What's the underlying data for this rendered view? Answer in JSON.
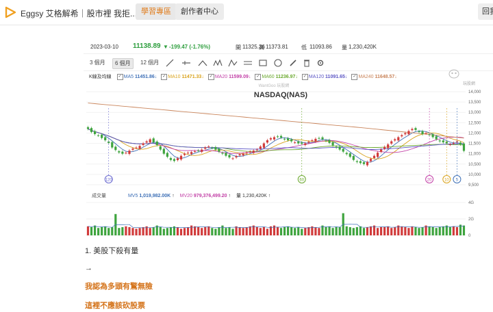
{
  "header": {
    "site_title": "Eggsy 艾格解希｜股市裡 我拒...",
    "learn_button": "學習專區",
    "creator_button": "創作者中心",
    "back_button": "回我"
  },
  "quote": {
    "date": "2023-03-10",
    "price": "11138.89",
    "change": "-199.47 (-1.76%)",
    "open_label": "開",
    "open": "11325.36",
    "high_label": "高",
    "high": "11373.81",
    "low_label": "低",
    "low": "11093.86",
    "volume_label": "量",
    "volume": "1,230,420K"
  },
  "periods": [
    "3 個月",
    "6 個月",
    "12 個月"
  ],
  "active_period": "6 個月",
  "tools": [
    "line-tool-icon",
    "ray-tool-icon",
    "triangle-tool-icon",
    "wave-tool-icon",
    "fibonacci-tool-icon",
    "parallel-tool-icon",
    "rectangle-tool-icon",
    "circle-tool-icon",
    "brush-tool-icon",
    "trash-icon",
    "settings-icon"
  ],
  "ma": {
    "label": "K線及均線",
    "items": [
      {
        "name": "MA5",
        "value": "11451.86",
        "dir": "↓",
        "color": "#3d6fb6"
      },
      {
        "name": "MA10",
        "value": "11471.33",
        "dir": "↓",
        "color": "#d9a21b"
      },
      {
        "name": "MA20",
        "value": "11599.09",
        "dir": "↓",
        "color": "#c23fa6"
      },
      {
        "name": "MA60",
        "value": "11236.97",
        "dir": "↓",
        "color": "#6aa82d"
      },
      {
        "name": "MA120",
        "value": "11091.65",
        "dir": "↓",
        "color": "#5b55c4"
      },
      {
        "name": "MA240",
        "value": "11648.57",
        "dir": "↓",
        "color": "#c9845a"
      }
    ]
  },
  "chart_title": "NASDAQ(NAS)",
  "watermark": "WantGoo 玩股網",
  "brand_badge": "玩股網",
  "volume": {
    "label": "成交量",
    "mv5_name": "MV5",
    "mv5": "1,019,982.00K",
    "mv5_dir": "↑",
    "mv20_name": "MV20",
    "mv20": "979,376,499.20",
    "mv20_dir": "↑",
    "volume_label": "量",
    "volume": "1,230,420K",
    "volume_dir": "↑"
  },
  "article": {
    "line1": "1. 美股下殺有量",
    "arrow": "→",
    "line2": "我認為多頭有驚無險",
    "line3": "這裡不應該砍股票"
  },
  "colors": {
    "up": "#d13b3b",
    "down": "#3ea43e",
    "accent": "#d4731a"
  },
  "chart_data": {
    "type": "candlestick",
    "title": "NASDAQ(NAS)",
    "y_ticks": [
      14000,
      13500,
      13000,
      12500,
      12000,
      11500,
      11000,
      10500,
      10000,
      9500
    ],
    "ylim": [
      9500,
      14000
    ],
    "volume_ticks": [
      "4G",
      "2G",
      "0"
    ],
    "markers": [
      {
        "label": "120",
        "color": "#6b6bd0"
      },
      {
        "label": "60",
        "color": "#6aa82d"
      },
      {
        "label": "20",
        "color": "#c23fa6"
      },
      {
        "label": "10",
        "color": "#d9a21b"
      },
      {
        "label": "5",
        "color": "#3d6fb6"
      }
    ],
    "closes": [
      12200,
      12050,
      11950,
      11880,
      11760,
      11650,
      11520,
      11300,
      11180,
      11060,
      11000,
      11050,
      11150,
      11250,
      11300,
      11380,
      11500,
      11600,
      11700,
      11550,
      11420,
      11200,
      11000,
      10850,
      10700,
      10650,
      10780,
      10900,
      11000,
      11050,
      11080,
      11120,
      11150,
      11200,
      11300,
      11350,
      11280,
      11200,
      11100,
      11000,
      10900,
      10820,
      10780,
      10880,
      10980,
      11000,
      11050,
      11100,
      11150,
      11200,
      11350,
      11500,
      11650,
      11750,
      11800,
      11820,
      11780,
      11700,
      11650,
      11600,
      11550,
      11500,
      11480,
      11500,
      11580,
      11650,
      11720,
      11750,
      11700,
      11620,
      11520,
      11400,
      11300,
      11200,
      11100,
      10980,
      10850,
      10700,
      10600,
      10550,
      10500,
      10600,
      10750,
      10900,
      11050,
      11200,
      11330,
      11450,
      11600,
      11700,
      11800,
      11900,
      12000,
      12100,
      12200,
      12150,
      12050,
      11950,
      12000,
      11900,
      11800,
      11700,
      11600,
      11550,
      11500,
      11450,
      11520,
      11600,
      11450,
      11138.89
    ],
    "volumes": [
      1.1,
      1.0,
      1.2,
      0.9,
      1.0,
      1.1,
      0.9,
      1.0,
      2.6,
      0.9,
      1.0,
      1.1,
      1.0,
      0.9,
      0.8,
      0.9,
      1.0,
      1.1,
      0.9,
      1.0,
      1.2,
      1.0,
      0.8,
      0.9,
      1.0,
      1.1,
      1.0,
      0.8,
      0.9,
      1.0,
      1.2,
      1.1,
      1.0,
      0.9,
      1.0,
      1.1,
      0.9,
      0.8,
      1.0,
      1.2,
      0.9,
      1.0,
      0.8,
      1.1,
      1.0,
      0.9,
      1.0,
      1.1,
      1.2,
      1.0,
      0.9,
      1.0,
      0.8,
      1.1,
      1.2,
      1.0,
      0.9,
      1.0,
      1.1,
      1.0,
      0.9,
      1.0,
      0.8,
      0.9,
      1.0,
      1.1,
      1.0,
      0.9,
      1.2,
      1.0,
      1.1,
      0.9,
      1.0,
      1.0,
      2.7,
      1.1,
      1.0,
      0.9,
      1.0,
      1.1,
      0.9,
      1.0,
      1.1,
      1.2,
      0.9,
      1.0,
      1.0,
      1.1,
      0.9,
      1.0,
      1.2,
      1.1,
      1.0,
      0.9,
      1.1,
      1.0,
      0.9,
      1.0,
      1.2,
      1.1,
      1.0,
      0.9,
      1.0,
      1.1,
      1.2,
      1.0,
      1.1,
      1.0,
      1.3,
      1.2
    ]
  }
}
